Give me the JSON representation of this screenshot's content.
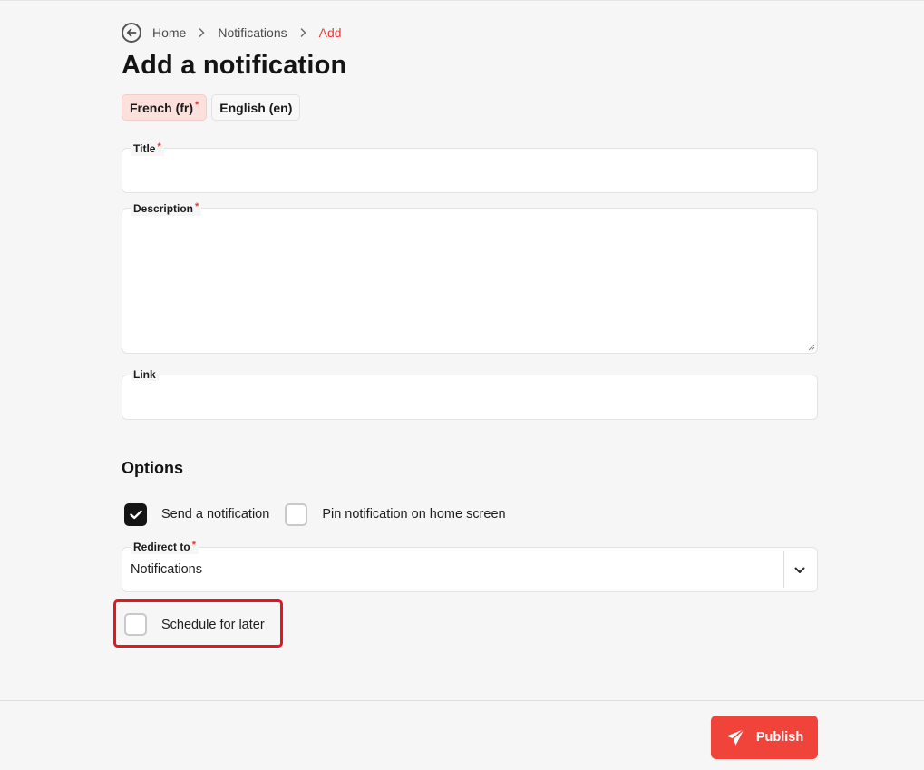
{
  "breadcrumb": {
    "items": [
      {
        "label": "Home"
      },
      {
        "label": "Notifications"
      },
      {
        "label": "Add"
      }
    ]
  },
  "page": {
    "title": "Add a notification"
  },
  "languages": [
    {
      "label": "French (fr)",
      "required_mark": "*",
      "active": true
    },
    {
      "label": "English (en)",
      "active": false
    }
  ],
  "form": {
    "title": {
      "label": "Title",
      "required_mark": "*",
      "value": ""
    },
    "description": {
      "label": "Description",
      "required_mark": "*",
      "value": ""
    },
    "link": {
      "label": "Link",
      "value": ""
    }
  },
  "options": {
    "heading": "Options",
    "send_notification": {
      "label": "Send a notification",
      "checked": true
    },
    "pin_notification": {
      "label": "Pin notification on home screen",
      "checked": false
    },
    "redirect": {
      "label": "Redirect to",
      "required_mark": "*",
      "value": "Notifications"
    },
    "schedule": {
      "label": "Schedule for later",
      "checked": false
    }
  },
  "footer": {
    "publish_label": "Publish"
  },
  "colors": {
    "accent": "#f0443b",
    "highlight": "#e8151d",
    "active_tab_bg": "#fbe0dc",
    "checkbox_checked": "#141414"
  },
  "icons": {
    "back": "arrow-left-circle-icon",
    "separator": "chevron-right-icon",
    "select": "chevron-down-icon",
    "publish": "paper-plane-icon",
    "check": "check-icon"
  }
}
